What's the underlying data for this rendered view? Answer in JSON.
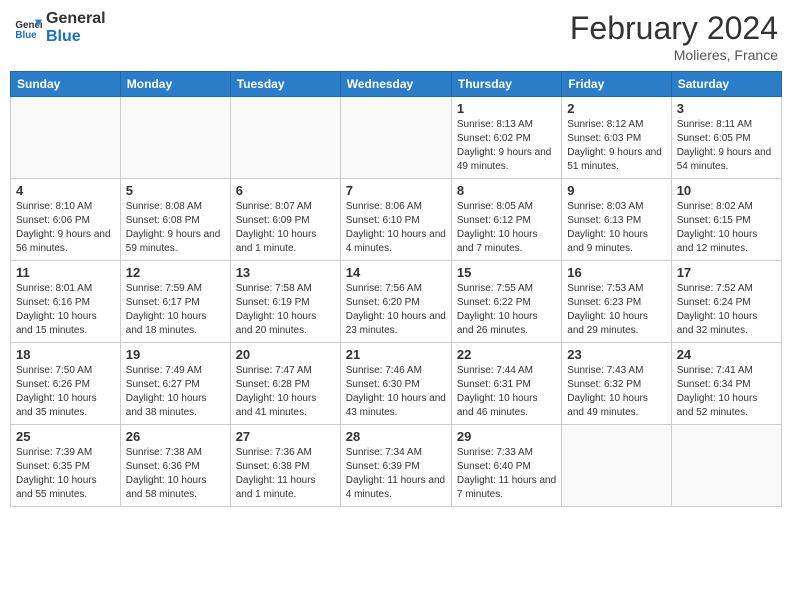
{
  "header": {
    "logo_line1": "General",
    "logo_line2": "Blue",
    "month_year": "February 2024",
    "location": "Molieres, France"
  },
  "days_of_week": [
    "Sunday",
    "Monday",
    "Tuesday",
    "Wednesday",
    "Thursday",
    "Friday",
    "Saturday"
  ],
  "weeks": [
    [
      {
        "day": "",
        "info": ""
      },
      {
        "day": "",
        "info": ""
      },
      {
        "day": "",
        "info": ""
      },
      {
        "day": "",
        "info": ""
      },
      {
        "day": "1",
        "info": "Sunrise: 8:13 AM\nSunset: 6:02 PM\nDaylight: 9 hours and 49 minutes."
      },
      {
        "day": "2",
        "info": "Sunrise: 8:12 AM\nSunset: 6:03 PM\nDaylight: 9 hours and 51 minutes."
      },
      {
        "day": "3",
        "info": "Sunrise: 8:11 AM\nSunset: 6:05 PM\nDaylight: 9 hours and 54 minutes."
      }
    ],
    [
      {
        "day": "4",
        "info": "Sunrise: 8:10 AM\nSunset: 6:06 PM\nDaylight: 9 hours and 56 minutes."
      },
      {
        "day": "5",
        "info": "Sunrise: 8:08 AM\nSunset: 6:08 PM\nDaylight: 9 hours and 59 minutes."
      },
      {
        "day": "6",
        "info": "Sunrise: 8:07 AM\nSunset: 6:09 PM\nDaylight: 10 hours and 1 minute."
      },
      {
        "day": "7",
        "info": "Sunrise: 8:06 AM\nSunset: 6:10 PM\nDaylight: 10 hours and 4 minutes."
      },
      {
        "day": "8",
        "info": "Sunrise: 8:05 AM\nSunset: 6:12 PM\nDaylight: 10 hours and 7 minutes."
      },
      {
        "day": "9",
        "info": "Sunrise: 8:03 AM\nSunset: 6:13 PM\nDaylight: 10 hours and 9 minutes."
      },
      {
        "day": "10",
        "info": "Sunrise: 8:02 AM\nSunset: 6:15 PM\nDaylight: 10 hours and 12 minutes."
      }
    ],
    [
      {
        "day": "11",
        "info": "Sunrise: 8:01 AM\nSunset: 6:16 PM\nDaylight: 10 hours and 15 minutes."
      },
      {
        "day": "12",
        "info": "Sunrise: 7:59 AM\nSunset: 6:17 PM\nDaylight: 10 hours and 18 minutes."
      },
      {
        "day": "13",
        "info": "Sunrise: 7:58 AM\nSunset: 6:19 PM\nDaylight: 10 hours and 20 minutes."
      },
      {
        "day": "14",
        "info": "Sunrise: 7:56 AM\nSunset: 6:20 PM\nDaylight: 10 hours and 23 minutes."
      },
      {
        "day": "15",
        "info": "Sunrise: 7:55 AM\nSunset: 6:22 PM\nDaylight: 10 hours and 26 minutes."
      },
      {
        "day": "16",
        "info": "Sunrise: 7:53 AM\nSunset: 6:23 PM\nDaylight: 10 hours and 29 minutes."
      },
      {
        "day": "17",
        "info": "Sunrise: 7:52 AM\nSunset: 6:24 PM\nDaylight: 10 hours and 32 minutes."
      }
    ],
    [
      {
        "day": "18",
        "info": "Sunrise: 7:50 AM\nSunset: 6:26 PM\nDaylight: 10 hours and 35 minutes."
      },
      {
        "day": "19",
        "info": "Sunrise: 7:49 AM\nSunset: 6:27 PM\nDaylight: 10 hours and 38 minutes."
      },
      {
        "day": "20",
        "info": "Sunrise: 7:47 AM\nSunset: 6:28 PM\nDaylight: 10 hours and 41 minutes."
      },
      {
        "day": "21",
        "info": "Sunrise: 7:46 AM\nSunset: 6:30 PM\nDaylight: 10 hours and 43 minutes."
      },
      {
        "day": "22",
        "info": "Sunrise: 7:44 AM\nSunset: 6:31 PM\nDaylight: 10 hours and 46 minutes."
      },
      {
        "day": "23",
        "info": "Sunrise: 7:43 AM\nSunset: 6:32 PM\nDaylight: 10 hours and 49 minutes."
      },
      {
        "day": "24",
        "info": "Sunrise: 7:41 AM\nSunset: 6:34 PM\nDaylight: 10 hours and 52 minutes."
      }
    ],
    [
      {
        "day": "25",
        "info": "Sunrise: 7:39 AM\nSunset: 6:35 PM\nDaylight: 10 hours and 55 minutes."
      },
      {
        "day": "26",
        "info": "Sunrise: 7:38 AM\nSunset: 6:36 PM\nDaylight: 10 hours and 58 minutes."
      },
      {
        "day": "27",
        "info": "Sunrise: 7:36 AM\nSunset: 6:38 PM\nDaylight: 11 hours and 1 minute."
      },
      {
        "day": "28",
        "info": "Sunrise: 7:34 AM\nSunset: 6:39 PM\nDaylight: 11 hours and 4 minutes."
      },
      {
        "day": "29",
        "info": "Sunrise: 7:33 AM\nSunset: 6:40 PM\nDaylight: 11 hours and 7 minutes."
      },
      {
        "day": "",
        "info": ""
      },
      {
        "day": "",
        "info": ""
      }
    ]
  ]
}
